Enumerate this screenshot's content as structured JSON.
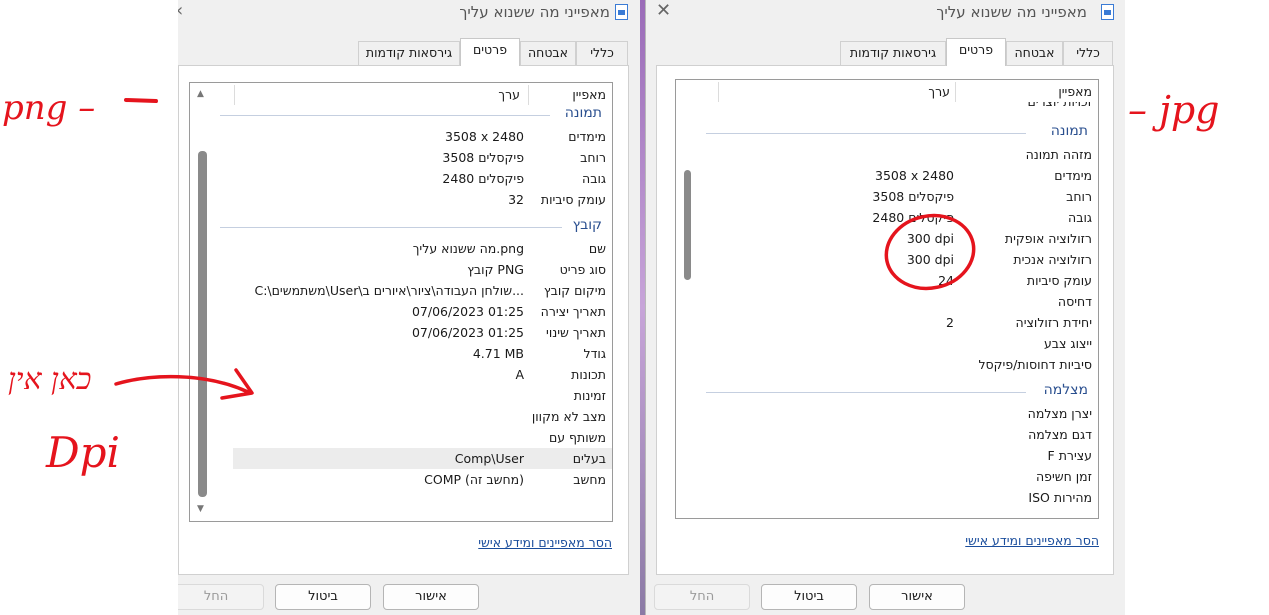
{
  "window": {
    "title": "מאפייני מה ששנוא עליך",
    "tabs": [
      "כללי",
      "אבטחה",
      "פרטים",
      "גירסאות קודמות"
    ],
    "header": {
      "property": "מאפיין",
      "value": "ערך"
    },
    "remove_link": "הסר מאפיינים ומידע אישי",
    "buttons": {
      "ok": "אישור",
      "cancel": "ביטול",
      "apply": "החל"
    }
  },
  "left": {
    "groups": {
      "image": "תמונה",
      "file": "קובץ"
    },
    "image_rows": [
      {
        "prop": "מימדים",
        "val": "3508 x 2480"
      },
      {
        "prop": "רוחב",
        "val": "3508 פיקסלים"
      },
      {
        "prop": "גובה",
        "val": "2480 פיקסלים"
      },
      {
        "prop": "עומק סיביות",
        "val": "32"
      }
    ],
    "file_rows": [
      {
        "prop": "שם",
        "val": "מה ששנוא עליך.png"
      },
      {
        "prop": "סוג פריט",
        "val": "קובץ PNG"
      },
      {
        "prop": "מיקום קובץ",
        "val": "C:\\משתמשים\\User\\שולחן העבודה\\ציור\\איורים ב..."
      },
      {
        "prop": "תאריך יצירה",
        "val": "07/06/2023 01:25"
      },
      {
        "prop": "תאריך שינוי",
        "val": "07/06/2023 01:25"
      },
      {
        "prop": "גודל",
        "val": "4.71 MB"
      },
      {
        "prop": "תכונות",
        "val": "A"
      },
      {
        "prop": "זמינות",
        "val": ""
      },
      {
        "prop": "מצב לא מקוון",
        "val": ""
      },
      {
        "prop": "משותף עם",
        "val": ""
      },
      {
        "prop": "בעלים",
        "val": "Comp\\User"
      },
      {
        "prop": "מחשב",
        "val": "COMP (מחשב זה)"
      }
    ]
  },
  "right": {
    "partial_row": "זכויות יוצרים",
    "groups": {
      "image": "תמונה",
      "camera": "מצלמה"
    },
    "image_rows": [
      {
        "prop": "מזהה תמונה",
        "val": ""
      },
      {
        "prop": "מימדים",
        "val": "3508 x 2480"
      },
      {
        "prop": "רוחב",
        "val": "3508 פיקסלים"
      },
      {
        "prop": "גובה",
        "val": "2480 פיקסלים"
      },
      {
        "prop": "רזולוציה אופקית",
        "val": "300 dpi"
      },
      {
        "prop": "רזולוציה אנכית",
        "val": "300 dpi"
      },
      {
        "prop": "עומק סיביות",
        "val": "24"
      },
      {
        "prop": "דחיסה",
        "val": ""
      },
      {
        "prop": "יחידת רזולוציה",
        "val": "2"
      },
      {
        "prop": "ייצוג צבע",
        "val": ""
      },
      {
        "prop": "סיביות דחוסות/פיקסל",
        "val": ""
      }
    ],
    "camera_rows": [
      {
        "prop": "יצרן מצלמה",
        "val": ""
      },
      {
        "prop": "דגם מצלמה",
        "val": ""
      },
      {
        "prop": "עצירת F",
        "val": ""
      },
      {
        "prop": "זמן חשיפה",
        "val": ""
      },
      {
        "prop": "מהירות ISO",
        "val": ""
      }
    ]
  },
  "annotations": {
    "png_label": "png –",
    "jpg_label": "– jpg",
    "no_label": "כאן אין",
    "dpi_label": "Dpi"
  }
}
